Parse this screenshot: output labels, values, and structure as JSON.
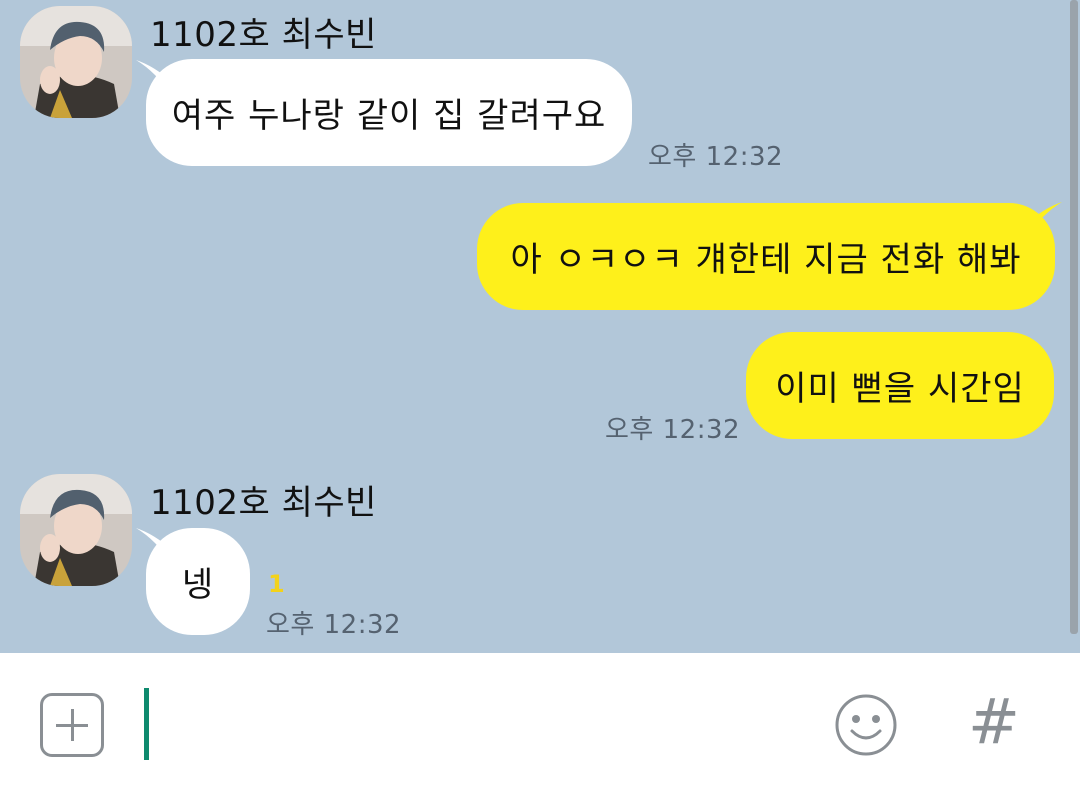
{
  "messages": [
    {
      "sender": "1102호 최수빈",
      "text": "여주 누나랑 같이 집 갈려구요",
      "time": "오후 12:32",
      "direction": "in"
    },
    {
      "text": "아 ㅇㅋㅇㅋ 걔한테 지금 전화 해봐",
      "direction": "out"
    },
    {
      "text": "이미 뻗을 시간임",
      "time": "오후 12:32",
      "direction": "out"
    },
    {
      "sender": "1102호 최수빈",
      "text": "넹",
      "unread": "1",
      "time": "오후 12:32",
      "direction": "in"
    }
  ],
  "input": {
    "value": "",
    "add_icon": "plus-square-icon",
    "emoji_icon": "smiley-icon",
    "hash_label": "#"
  },
  "colors": {
    "chat_background": "#b2c7d9",
    "incoming_bubble": "#ffffff",
    "outgoing_bubble": "#fef01b",
    "unread_count": "#f3d21a",
    "caret": "#0e8a6e"
  }
}
